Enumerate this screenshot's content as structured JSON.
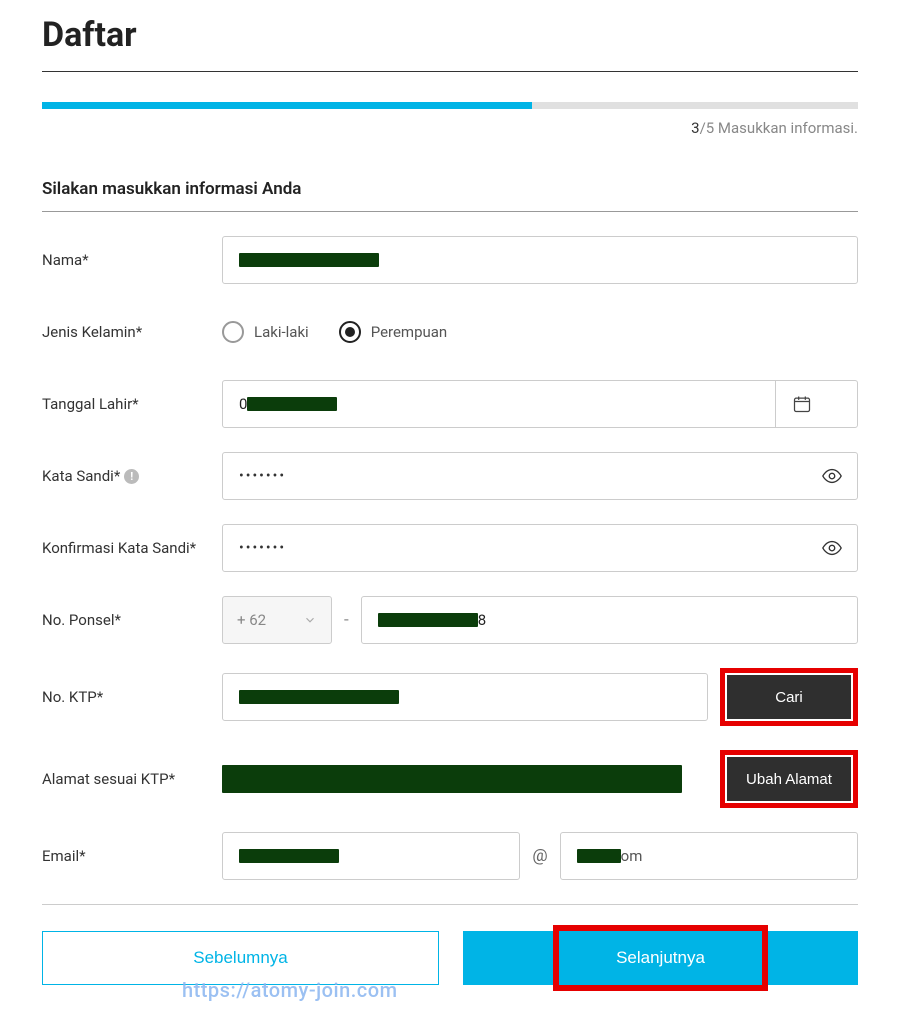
{
  "page": {
    "title": "Daftar"
  },
  "progress": {
    "step_current": "3",
    "step_total": "/5",
    "label": " Masukkan informasi.",
    "percent": 60
  },
  "section": {
    "title": "Silakan masukkan informasi Anda"
  },
  "fields": {
    "name": {
      "label": "Nama*",
      "value": "████████████"
    },
    "gender": {
      "label": "Jenis Kelamin*",
      "options": [
        {
          "label": "Laki-laki",
          "selected": false
        },
        {
          "label": "Perempuan",
          "selected": true
        }
      ]
    },
    "dob": {
      "label": "Tanggal Lahir*",
      "value": "██████████"
    },
    "password": {
      "label": "Kata Sandi*",
      "value": "•••••••"
    },
    "password_confirm": {
      "label": "Konfirmasi Kata Sandi*",
      "value": "•••••••"
    },
    "phone": {
      "label": "No. Ponsel*",
      "prefix": "+ 62",
      "value": "██████████8"
    },
    "ktp": {
      "label": "No. KTP*",
      "value": "████████████████",
      "button": "Cari"
    },
    "address": {
      "label": "Alamat sesuai KTP*",
      "value": "██████████████████████████████████████████████████",
      "button": "Ubah Alamat"
    },
    "email": {
      "label": "Email*",
      "local": "█████████",
      "at": "@",
      "domain_suffix": "om"
    }
  },
  "nav": {
    "prev": "Sebelumnya",
    "next": "Selanjutnya"
  },
  "watermark": "https://atomy-join.com"
}
